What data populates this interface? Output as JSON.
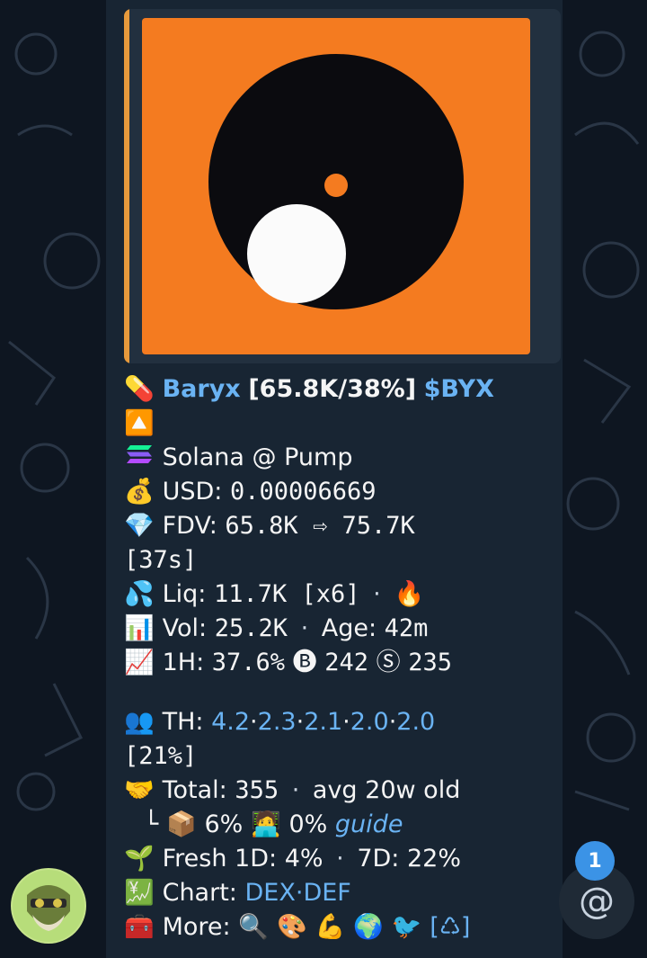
{
  "message": {
    "token_name": "Baryx",
    "token_stats": "[65.8K/38%]",
    "ticker": "$BYX",
    "chain_line": "Solana @ Pump",
    "usd_label": "USD:",
    "usd_value": "0.00006669",
    "fdv_label": "FDV:",
    "fdv_value": "65.8K ⇨ 75.7K",
    "fdv_time": "[37s]",
    "liq_label": "Liq:",
    "liq_value": "11.7K [x6]",
    "vol_label": "Vol:",
    "vol_value": "25.2K",
    "age_label": "Age:",
    "age_value": "42m",
    "change_label": "1H:",
    "change_value": "37.6%",
    "buys_value": "242",
    "sells_value": "235",
    "th_label": "TH:",
    "th_values": [
      "4.2",
      "2.3",
      "2.1",
      "2.0",
      "2.0"
    ],
    "th_percent": "[21%]",
    "total_label": "Total:",
    "total_value": "355",
    "avg_text": "avg 20w old",
    "tree_branch": "└",
    "box_pct": "6%",
    "dev_pct": "0%",
    "guide_link": "guide",
    "fresh_label": "Fresh 1D:",
    "fresh_1d": "4%",
    "fresh_7d_label": "7D:",
    "fresh_7d": "22%",
    "chart_label": "Chart:",
    "chart_links": [
      "DEX",
      "DEF"
    ],
    "more_label": "More:",
    "recycle_link": "[♺]"
  },
  "emojis": {
    "pill": "💊",
    "up_button": "🔼",
    "money_bag": "💰",
    "diamond": "💎",
    "droplets": "💦",
    "fire": "🔥",
    "bar_chart": "📊",
    "trend_up": "📈",
    "buy_circle": "🅑",
    "sell_circle": "Ⓢ",
    "people": "👥",
    "handshake": "🤝",
    "box": "📦",
    "technologist": "🧑‍💻",
    "seedling": "🌱",
    "chart_yen": "💹",
    "toolbox": "🧰",
    "more_icons": [
      "🔍",
      "🎨",
      "💪",
      "🌍",
      "🐦"
    ]
  },
  "mentions": {
    "count": "1",
    "symbol": "@"
  },
  "colors": {
    "background": "#0e1621",
    "bubble": "#182533",
    "link": "#6ab3f3",
    "image_bg": "#f47b20",
    "accent": "#e79a3c",
    "badge": "#3b93e6"
  }
}
